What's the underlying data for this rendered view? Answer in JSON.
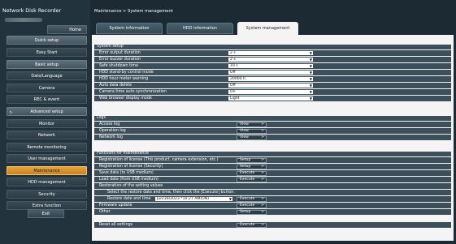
{
  "app": {
    "title": "Network Disk Recorder"
  },
  "sidebar": {
    "home": "Home",
    "quick_setup": "Quick setup",
    "easy_start": "Easy Start",
    "basic_setup": "Basic setup",
    "date_language": "Date/Language",
    "camera": "Camera",
    "rec_event": "REC & event",
    "advanced_setup": "Advanced setup",
    "monitor": "Monitor",
    "network": "Network",
    "remote_monitoring": "Remote monitoring",
    "user_management": "User management",
    "maintenance": "Maintenance",
    "hdd_management": "HDD management",
    "security": "Security",
    "extra_function": "Extra function",
    "exit": "Exit"
  },
  "breadcrumb": "Maintenance > System management",
  "tabs": [
    "System information",
    "HDD information",
    "System management"
  ],
  "system_setup": {
    "title": "System setup",
    "rows": [
      {
        "label": "Error output duration",
        "value": "2 s"
      },
      {
        "label": "Error buzzer duration",
        "value": "2 s"
      },
      {
        "label": "Safe shutdown time",
        "value": "10 s"
      },
      {
        "label": "HDD stand-by control mode",
        "value": "Off"
      },
      {
        "label": "HDD hour meter warning",
        "value": "20000 h"
      },
      {
        "label": "Auto data delete",
        "value": "Off"
      },
      {
        "label": "Camera time auto synchronization",
        "value": "On"
      },
      {
        "label": "Web browser display mode",
        "value": "Light"
      }
    ]
  },
  "logs": {
    "title": "Logs",
    "rows": [
      {
        "label": "Access log",
        "button": "View"
      },
      {
        "label": "Operation log",
        "button": "View"
      },
      {
        "label": "Network log",
        "button": "View"
      }
    ]
  },
  "maintenance_functions": {
    "title": "Functions for maintenance",
    "reg_license_product": "Registration of license (This product, camera extension, etc.)",
    "reg_license_security": "Registration of license (Security)",
    "save_data": "Save data (to USB medium)",
    "load_data": "Load data (from USB medium)",
    "restoration": "Restoration of the setting values",
    "restore_hint": "Select the restore date and time, then click the [Execute] button.",
    "restore_datetime_label": "Restore date and time",
    "restore_datetime_value": "Jun/30/2023 *10:27 AM(ON)",
    "firmware_update": "Firmware update",
    "other": "Other",
    "reset_all": "Reset all settings",
    "btn_setup": "Setup",
    "btn_execute": "Execute"
  },
  "icons": {
    "dropdown": "▼",
    "chevron": ">",
    "expand": "▷"
  }
}
